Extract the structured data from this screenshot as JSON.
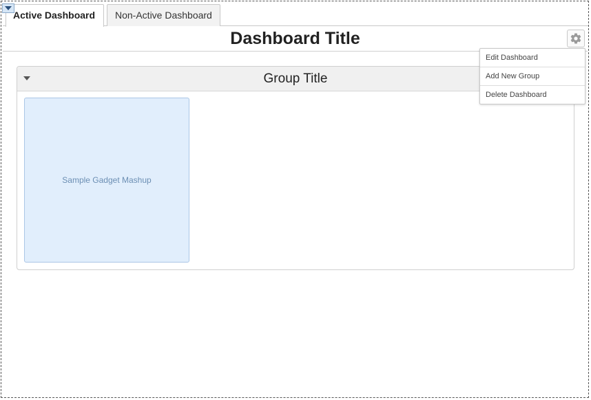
{
  "tabs": [
    {
      "label": "Active Dashboard",
      "active": true
    },
    {
      "label": "Non-Active Dashboard",
      "active": false
    }
  ],
  "dashboard": {
    "title": "Dashboard Title",
    "settings_icon": "gear-icon"
  },
  "settings_menu": {
    "items": [
      "Edit Dashboard",
      "Add New Group",
      "Delete Dashboard"
    ]
  },
  "group": {
    "title": "Group Title",
    "toggle_icon": "caret-down-icon",
    "gadgets": [
      {
        "label": "Sample Gadget Mashup"
      }
    ]
  },
  "colors": {
    "gadget_bg": "#e1eefc",
    "gadget_border": "#aac6e6",
    "gadget_text": "#6b8eb3",
    "group_header_bg": "#f0f0f0"
  }
}
